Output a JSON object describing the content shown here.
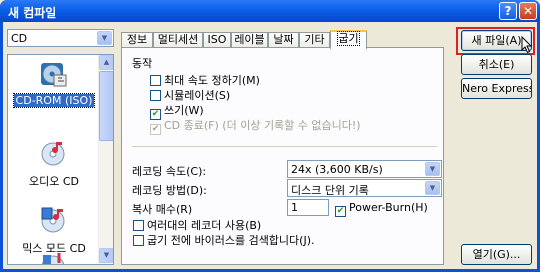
{
  "window": {
    "title": "새 컴파일",
    "help_glyph": "?",
    "close_glyph": "✕"
  },
  "device_select": {
    "value": "CD"
  },
  "project_list": {
    "items": [
      {
        "label": "CD-ROM (ISO)",
        "icon": "disc-iso-icon",
        "selected": true
      },
      {
        "label": "오디오 CD",
        "icon": "audio-cd-icon",
        "selected": false
      },
      {
        "label": "믹스 모드 CD",
        "icon": "mixed-mode-cd-icon",
        "selected": false
      },
      {
        "label": "",
        "icon": "cd-icon",
        "selected": false
      }
    ]
  },
  "tabs": [
    {
      "label": "정보",
      "active": false
    },
    {
      "label": "멀티세션",
      "active": false
    },
    {
      "label": "ISO",
      "active": false
    },
    {
      "label": "레이블",
      "active": false
    },
    {
      "label": "날짜",
      "active": false
    },
    {
      "label": "기타",
      "active": false
    },
    {
      "label": "굽기",
      "active": true
    }
  ],
  "burn_tab": {
    "action_group": "동작",
    "options": [
      {
        "label": "최대 속도 정하기(M)",
        "checked": false,
        "disabled": false
      },
      {
        "label": "시뮬레이션(S)",
        "checked": false,
        "disabled": false
      },
      {
        "label": "쓰기(W)",
        "checked": true,
        "disabled": false
      },
      {
        "label": "CD 종료(F) (더 이상 기록할 수 없습니다!)",
        "checked": true,
        "disabled": true
      }
    ],
    "speed_label": "레코딩 속도(C):",
    "speed_value": "24x (3,600 KB/s)",
    "method_label": "레코딩 방법(D):",
    "method_value": "디스크 단위 기록",
    "copies_label": "복사 매수(R)",
    "copies_value": "1",
    "powerburn_label": "Power-Burn(H)",
    "powerburn_checked": true,
    "multi_recorder_label": "여러대의 레코더 사용(B)",
    "virus_check_label": "굽기 전에 바이러스를 검색합니다(J)."
  },
  "buttons": {
    "new": "새 파일(A)",
    "cancel": "취소(E)",
    "nero_express": "Nero Express(I",
    "open": "열기(G)..."
  },
  "colors": {
    "highlight": "#e02020",
    "selection": "#316ac5",
    "title_bar": "#0a5fe8"
  }
}
